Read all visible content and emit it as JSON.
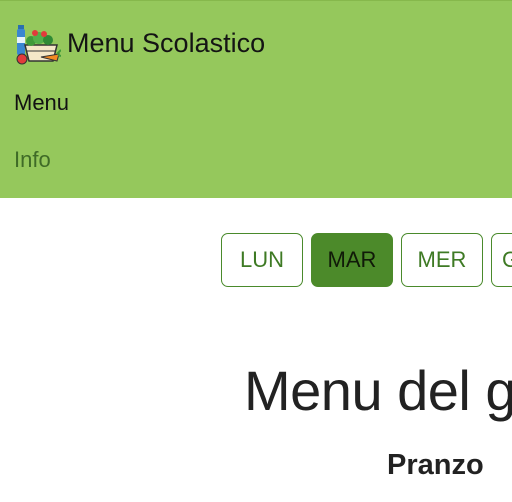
{
  "navbar": {
    "brand": "Menu Scolastico",
    "links": [
      {
        "label": "Menu"
      },
      {
        "label": "Info"
      }
    ]
  },
  "days": [
    {
      "label": "LUN",
      "active": false
    },
    {
      "label": "MAR",
      "active": true
    },
    {
      "label": "MER",
      "active": false
    },
    {
      "label": "G",
      "active": false
    }
  ],
  "main": {
    "title": "Menu del g",
    "section": "Pranzo"
  },
  "colors": {
    "navbar_bg": "#95c85c",
    "accent": "#4c8a2a",
    "link_muted": "#3f6b27"
  }
}
